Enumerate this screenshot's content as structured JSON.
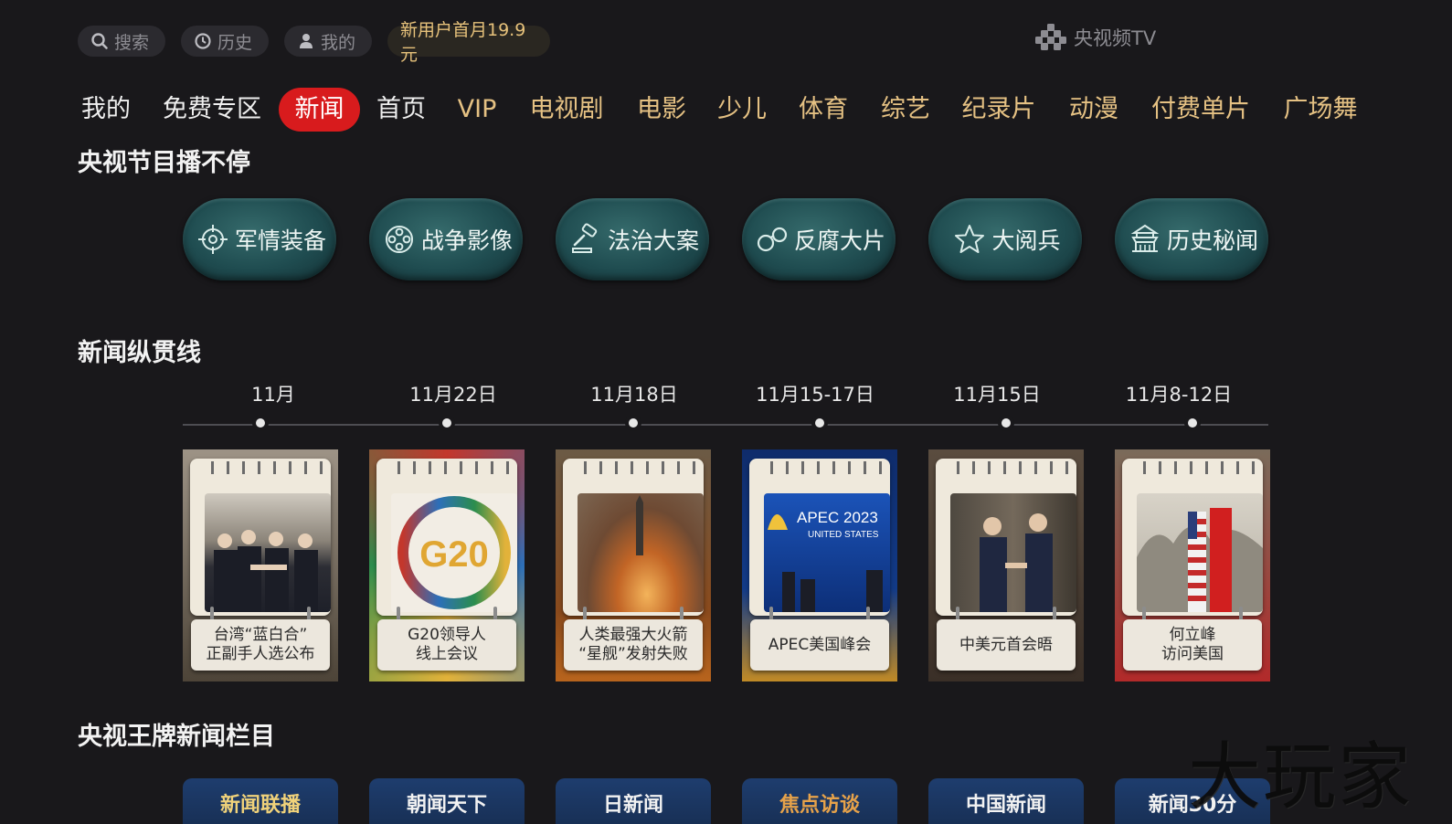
{
  "top_bar": {
    "search_label": "搜索",
    "history_label": "历史",
    "mine_label": "我的",
    "promo_label": "新用户首月19.9元",
    "brand_label": "央视频TV"
  },
  "nav": {
    "items": [
      "我的",
      "免费专区",
      "新闻",
      "首页",
      "VIP",
      "电视剧",
      "电影",
      "少儿",
      "体育",
      "综艺",
      "纪录片",
      "动漫",
      "付费单片",
      "广场舞"
    ],
    "active": "新闻"
  },
  "sections": {
    "programs_title": "央视节目播不停",
    "timeline_title": "新闻纵贯线",
    "flagship_title": "央视王牌新闻栏目"
  },
  "categories": [
    {
      "label": "军情装备",
      "icon": "crosshair-icon"
    },
    {
      "label": "战争影像",
      "icon": "film-reel-icon"
    },
    {
      "label": "法治大案",
      "icon": "gavel-icon"
    },
    {
      "label": "反腐大片",
      "icon": "handcuffs-icon"
    },
    {
      "label": "大阅兵",
      "icon": "star-icon"
    },
    {
      "label": "历史秘闻",
      "icon": "pagoda-icon"
    }
  ],
  "timeline": [
    {
      "date": "11月",
      "caption_lines": [
        "台湾“蓝白合”",
        "正副手人选公布"
      ]
    },
    {
      "date": "11月22日",
      "caption_lines": [
        "G20领导人",
        "线上会议"
      ],
      "photo_text": "G20"
    },
    {
      "date": "11月18日",
      "caption_lines": [
        "人类最强大火箭",
        "“星舰”发射失败"
      ]
    },
    {
      "date": "11月15-17日",
      "caption_lines": [
        "APEC美国峰会"
      ],
      "photo_text": "APEC 2023",
      "photo_subtext": "UNITED STATES"
    },
    {
      "date": "11月15日",
      "caption_lines": [
        "中美元首会晤"
      ]
    },
    {
      "date": "11月8-12日",
      "caption_lines": [
        "何立峰",
        "访问美国"
      ]
    }
  ],
  "flagship": [
    "新闻联播",
    "朝闻天下",
    "日新闻",
    "焦点访谈",
    "中国新闻",
    "新闻30分"
  ],
  "watermark": "大玩家",
  "colors": {
    "background": "#19181b",
    "nav_gold": "#e5c183",
    "active_red": "#d81b1d",
    "category_teal": "#1f4c50"
  }
}
